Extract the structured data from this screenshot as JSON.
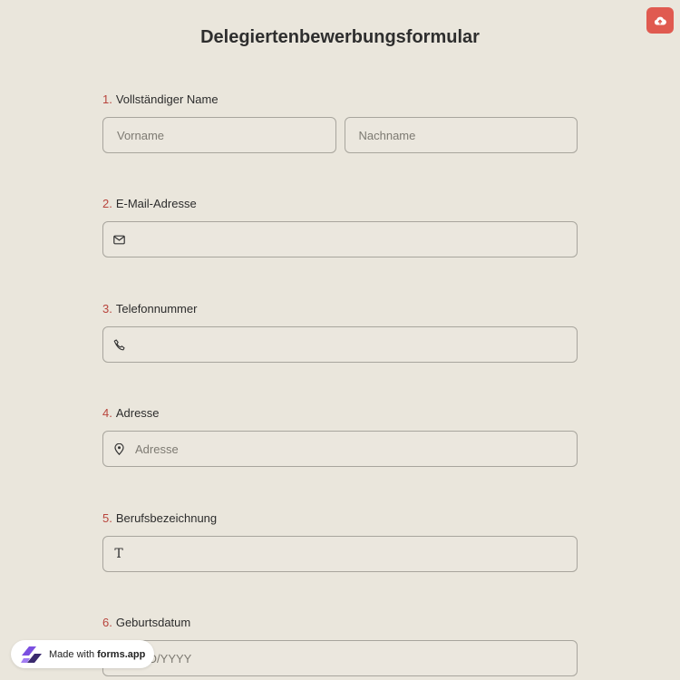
{
  "form": {
    "title": "Delegiertenbewerbungsformular",
    "questions": [
      {
        "number": "1.",
        "label": "Vollständiger Name",
        "fields": [
          {
            "placeholder": "Vorname"
          },
          {
            "placeholder": "Nachname"
          }
        ]
      },
      {
        "number": "2.",
        "label": "E-Mail-Adresse",
        "icon": "mail-icon",
        "placeholder": ""
      },
      {
        "number": "3.",
        "label": "Telefonnummer",
        "icon": "phone-icon",
        "placeholder": ""
      },
      {
        "number": "4.",
        "label": "Adresse",
        "icon": "location-pin-icon",
        "placeholder": "Adresse"
      },
      {
        "number": "5.",
        "label": "Berufsbezeichnung",
        "icon": "text-t-icon",
        "icon_glyph": "T",
        "placeholder": ""
      },
      {
        "number": "6.",
        "label": "Geburtsdatum",
        "placeholder": "MM/DD/YYYY"
      }
    ]
  },
  "badge": {
    "prefix": "Made with",
    "brand": "forms.app"
  },
  "colors": {
    "background": "#eae6dc",
    "accent_number": "#b8443c",
    "upload_button": "#e05a50"
  },
  "icons": {
    "upload": "cloud-upload-icon",
    "logo": "forms-app-logo-icon"
  }
}
